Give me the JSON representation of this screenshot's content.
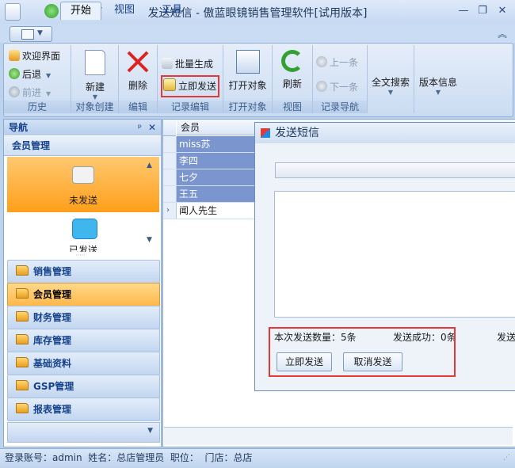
{
  "window": {
    "title": "发送短信 - 傲蓝眼镜销售管理软件[试用版本]",
    "controls": [
      "minimize-icon",
      "restore-icon",
      "close-icon"
    ]
  },
  "ribbon": {
    "tabs": [
      "开始",
      "视图",
      "工具"
    ],
    "active_tab": "开始",
    "groups": {
      "history": {
        "label": "历史",
        "welcome": "欢迎界面",
        "back": "后退",
        "forward": "前进"
      },
      "create": {
        "label": "对象创建",
        "new": "新建"
      },
      "edit": {
        "label": "编辑",
        "delete": "删除"
      },
      "record_edit": {
        "label": "记录编辑",
        "batch": "批量生成",
        "send_now": "立即发送"
      },
      "open": {
        "label": "打开对象",
        "open_object": "打开对象"
      },
      "view": {
        "label": "视图",
        "refresh": "刷新"
      },
      "record_nav": {
        "label": "记录导航",
        "prev": "上一条",
        "next": "下一条"
      },
      "search": {
        "label": "全文搜索"
      },
      "version": {
        "label": "版本信息"
      }
    }
  },
  "nav": {
    "title": "导航",
    "pin": "ᵖ",
    "close": "✕",
    "section": "会员管理",
    "tiles": [
      {
        "label": "未发送",
        "icon": "message-bubble-gray-icon"
      },
      {
        "label": "已发送",
        "icon": "message-bubble-blue-icon"
      }
    ],
    "items": [
      "销售管理",
      "会员管理",
      "财务管理",
      "库存管理",
      "基础资料",
      "GSP管理",
      "报表管理"
    ],
    "selected": "会员管理"
  },
  "grid": {
    "header": "会员",
    "rows": [
      {
        "name": "miss苏",
        "selected": true
      },
      {
        "name": "李四",
        "selected": true
      },
      {
        "name": "七夕",
        "selected": true
      },
      {
        "name": "王五",
        "selected": true
      },
      {
        "name": "闻人先生",
        "selected": false
      }
    ]
  },
  "dialog": {
    "title": "发送短信",
    "count_text": "本次发送数量：5条",
    "success_text": "发送成功：0条",
    "fail_text": "发送",
    "send_button": "立即发送",
    "cancel_button": "取消发送",
    "progress": 0
  },
  "status": {
    "text": "登录账号：admin  姓名：总店管理员  职位：  门店：总店"
  },
  "colors": {
    "accent": "#15428b",
    "highlight_box": "#e53935",
    "selected_row": "#7b96cf",
    "selected_nav": "#ffb84a"
  }
}
